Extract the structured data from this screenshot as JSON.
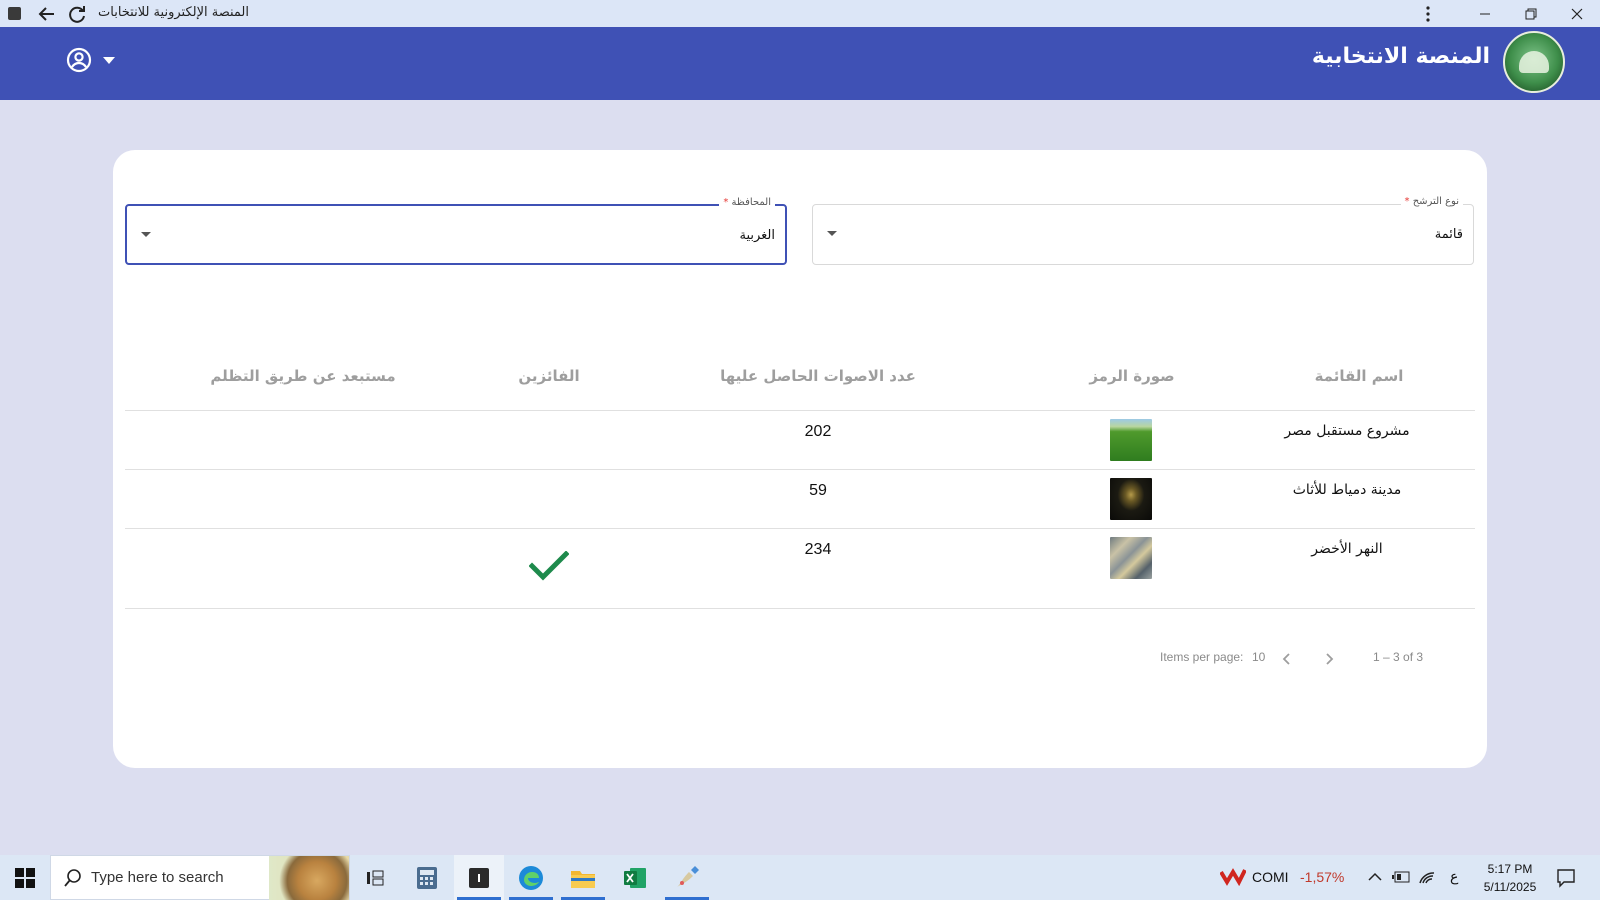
{
  "browser": {
    "tab_title": "المنصة الإلكترونية للانتخابات"
  },
  "header": {
    "title": "المنصة الانتخابية"
  },
  "filters": {
    "governorate": {
      "label": "المحافظة",
      "required_mark": "*",
      "value": "الغربية"
    },
    "candidacy_type": {
      "label": "نوع الترشح",
      "required_mark": "*",
      "value": "قائمة"
    }
  },
  "table": {
    "columns": [
      "اسم القائمة",
      "صورة الرمز",
      "عدد الاصوات الحاصل عليها",
      "الفائزين",
      "مستبعد عن طريق التظلم"
    ],
    "rows": [
      {
        "list_name": "مشروع مستقبل مصر",
        "symbol_image": "green-field-image",
        "votes": "202",
        "winner": false,
        "excluded": ""
      },
      {
        "list_name": "مدينة دمياط للأثاث",
        "symbol_image": "dark-emblem-image",
        "votes": "59",
        "winner": false,
        "excluded": ""
      },
      {
        "list_name": "النهر الأخضر",
        "symbol_image": "city-aerial-image",
        "votes": "234",
        "winner": true,
        "excluded": ""
      }
    ]
  },
  "paginator": {
    "items_per_page_label": "Items per page:",
    "page_size": "10",
    "range": "1 – 3 of 3"
  },
  "taskbar": {
    "search_placeholder": "Type here to search",
    "ticker_symbol": "COMI",
    "ticker_change": "-1,57%",
    "input_lang": "ع",
    "time": "5:17 PM",
    "date": "5/11/2025"
  },
  "colors": {
    "primary": "#3f51b5",
    "page_bg": "#dcdef0",
    "winner_check": "#1e8a4c"
  }
}
